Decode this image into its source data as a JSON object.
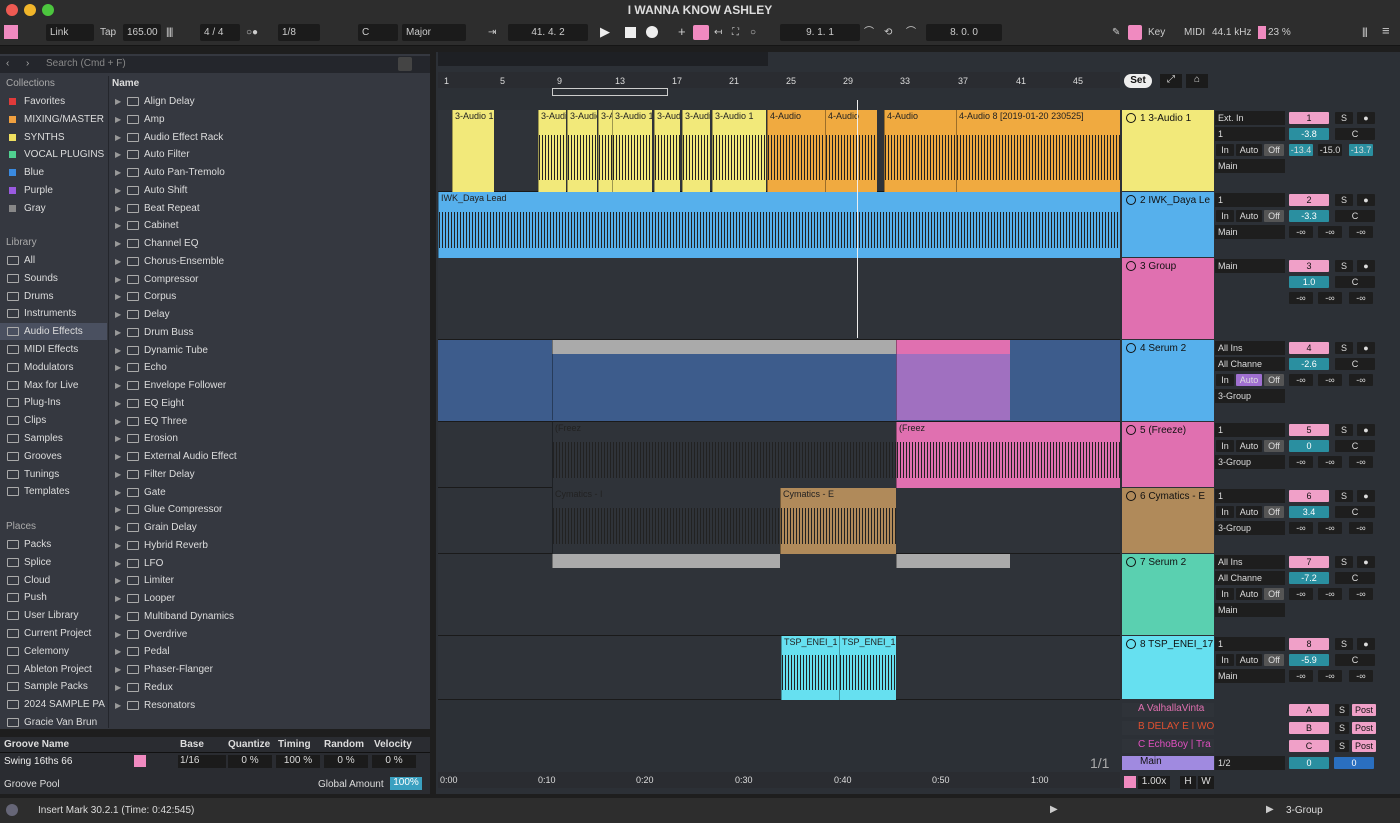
{
  "title": "I WANNA KNOW ASHLEY",
  "top": {
    "link": "Link",
    "tap": "Tap",
    "tempo": "165.00",
    "sig": "4 / 4",
    "quant": "1/8",
    "key": "C",
    "scale": "Major",
    "pos": "41.  4.  2",
    "pos2": "9.  1.  1",
    "pos3": "8.  0.  0",
    "key_btn": "Key",
    "midi": "MIDI",
    "rate": "44.1 kHz",
    "cpu": "23 %"
  },
  "browser": {
    "search_placeholder": "Search (Cmd + F)",
    "collections_title": "Collections",
    "library_title": "Library",
    "places_title": "Places",
    "name_col": "Name",
    "collections": [
      {
        "label": "Favorites",
        "color": "#e03a3a"
      },
      {
        "label": "MIXING/MASTER",
        "color": "#f0a040"
      },
      {
        "label": "SYNTHS",
        "color": "#f0e060"
      },
      {
        "label": "VOCAL PLUGINS",
        "color": "#50d090"
      },
      {
        "label": "Blue",
        "color": "#3a8ae0"
      },
      {
        "label": "Purple",
        "color": "#9a5ae0"
      },
      {
        "label": "Gray",
        "color": "#888888"
      }
    ],
    "library": [
      "All",
      "Sounds",
      "Drums",
      "Instruments",
      "Audio Effects",
      "MIDI Effects",
      "Modulators",
      "Max for Live",
      "Plug-Ins",
      "Clips",
      "Samples",
      "Grooves",
      "Tunings",
      "Templates"
    ],
    "places": [
      "Packs",
      "Splice",
      "Cloud",
      "Push",
      "User Library",
      "Current Project",
      "Celemony",
      "Ableton Project",
      "Sample Packs",
      "2024 SAMPLE PA",
      "Gracie Van Brun"
    ],
    "items": [
      "Align Delay",
      "Amp",
      "Audio Effect Rack",
      "Auto Filter",
      "Auto Pan-Tremolo",
      "Auto Shift",
      "Beat Repeat",
      "Cabinet",
      "Channel EQ",
      "Chorus-Ensemble",
      "Compressor",
      "Corpus",
      "Delay",
      "Drum Buss",
      "Dynamic Tube",
      "Echo",
      "Envelope Follower",
      "EQ Eight",
      "EQ Three",
      "Erosion",
      "External Audio Effect",
      "Filter Delay",
      "Gate",
      "Glue Compressor",
      "Grain Delay",
      "Hybrid Reverb",
      "LFO",
      "Limiter",
      "Looper",
      "Multiband Dynamics",
      "Overdrive",
      "Pedal",
      "Phaser-Flanger",
      "Redux",
      "Resonators"
    ]
  },
  "groove": {
    "headers": [
      "Groove Name",
      "Base",
      "Quantize",
      "Timing",
      "Random",
      "Velocity"
    ],
    "name": "Swing 16ths 66",
    "base": "1/16",
    "quantize": "0 %",
    "timing": "100 %",
    "random": "0 %",
    "velocity": "0 %",
    "pool": "Groove Pool",
    "global_label": "Global Amount",
    "global_value": "100%"
  },
  "ruler": {
    "bars": [
      "1",
      "5",
      "9",
      "13",
      "17",
      "21",
      "25",
      "29",
      "33",
      "37",
      "41",
      "45"
    ],
    "set": "Set",
    "times": [
      "0:00",
      "0:10",
      "0:20",
      "0:30",
      "0:40",
      "0:50",
      "1:00"
    ],
    "page": "1/1"
  },
  "tracks": [
    {
      "name": "1 3-Audio 1",
      "color": "#f2e97a",
      "in": "Ext. In",
      "ch": "1",
      "out": "Main",
      "num": "1",
      "vol": "-3.8",
      "pan": "C",
      "m1": "-13.4",
      "m2": "-15.0",
      "m3": "-13.7"
    },
    {
      "name": "2 IWK_Daya Le",
      "color": "#56b0ec",
      "in": "1",
      "out": "Main",
      "num": "2",
      "vol": "-3.3",
      "pan": "C",
      "m1": "-∞",
      "m2": "-∞",
      "m3": "-∞",
      "clip": "IWK_Daya Lead"
    },
    {
      "name": "3 Group",
      "color": "#e070b0",
      "in": "Main",
      "num": "3",
      "vol": "1.0",
      "pan": "C",
      "m1": "-∞",
      "m2": "-∞",
      "m3": "-∞"
    },
    {
      "name": "4 Serum 2",
      "color": "#56b0ec",
      "in": "All Ins",
      "ch": "All Channe",
      "out": "3-Group",
      "num": "4",
      "vol": "-2.6",
      "pan": "C",
      "m1": "-∞",
      "m2": "-∞",
      "m3": "-∞"
    },
    {
      "name": "5 (Freeze)",
      "color": "#e070b0",
      "in": "1",
      "out": "3-Group",
      "num": "5",
      "vol": "0",
      "pan": "C",
      "m1": "-∞",
      "m2": "-∞",
      "m3": "-∞"
    },
    {
      "name": "6 Cymatics - E",
      "color": "#b08a5a",
      "in": "1",
      "out": "3-Group",
      "num": "6",
      "vol": "3.4",
      "pan": "C",
      "m1": "-∞",
      "m2": "-∞",
      "m3": "-∞"
    },
    {
      "name": "7 Serum 2",
      "color": "#5ad0b0",
      "in": "All Ins",
      "ch": "All Channe",
      "out": "Main",
      "num": "7",
      "vol": "-7.2",
      "pan": "C",
      "m1": "-∞",
      "m2": "-∞",
      "m3": "-∞"
    },
    {
      "name": "8 TSP_ENEI_17",
      "color": "#66e0f0",
      "in": "1",
      "out": "Main",
      "num": "8",
      "vol": "-5.9",
      "pan": "C",
      "m1": "-∞",
      "m2": "-∞",
      "m3": "-∞",
      "clip": "TSP_ENEI_1"
    }
  ],
  "returns": [
    {
      "name": "A ValhallaVinta",
      "letter": "A"
    },
    {
      "name": "B DELAY E I WO",
      "letter": "B"
    },
    {
      "name": "C EchoBoy | Tra",
      "letter": "C"
    }
  ],
  "master": {
    "name": "Main",
    "out": "1/2",
    "vol": "0",
    "pan": "0",
    "zoom": "1.00x"
  },
  "labels": {
    "in": "In",
    "auto": "Auto",
    "off": "Off",
    "s": "S",
    "post": "Post",
    "c": "C",
    "h": "H",
    "w": "W"
  },
  "clips": {
    "audio1": "3-Audio 1",
    "audio4": "4-Audio",
    "audio8": "4-Audio 8 [2019-01-20 230525]",
    "freeze": "(Freez",
    "cym": "Cymatics - I",
    "cym2": "Cymatics - E"
  },
  "status": {
    "message": "Insert Mark 30.2.1 (Time: 0:42:545)",
    "track": "3-Group"
  }
}
